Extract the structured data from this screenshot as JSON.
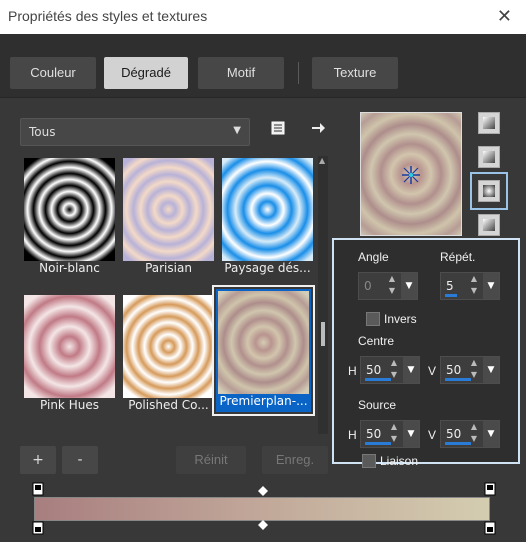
{
  "window": {
    "title": "Propriétés des styles et textures",
    "close_glyph": "✕"
  },
  "tabs": [
    {
      "label": "Couleur",
      "active": false
    },
    {
      "label": "Dégradé",
      "active": true
    },
    {
      "label": "Motif",
      "active": false
    },
    {
      "label": "Texture",
      "active": false
    }
  ],
  "category": {
    "selected": "Tous"
  },
  "gradients": [
    {
      "label": "Noir-blanc"
    },
    {
      "label": "Parisian"
    },
    {
      "label": "Paysage dés..."
    },
    {
      "label": "Pink Hues"
    },
    {
      "label": "Polished Co..."
    },
    {
      "label": "Premierplan-...",
      "selected": true
    }
  ],
  "buttons": {
    "add": "+",
    "remove": "-",
    "reset": "Réinit",
    "save": "Enreg."
  },
  "popup": {
    "angle_label": "Angle",
    "angle_value": "0",
    "repeat_label": "Répét.",
    "repeat_value": "5",
    "invert_label": "Invers",
    "center_label": "Centre",
    "center_h_label": "H",
    "center_h": "50",
    "center_v_label": "V",
    "center_v": "50",
    "source_label": "Source",
    "source_h_label": "H",
    "source_h": "50",
    "source_v_label": "V",
    "source_v": "50",
    "link_label": "Liaison"
  },
  "colors": {
    "accent": "#0a64c6",
    "gradient_start": "#a87e7f",
    "gradient_end": "#d4cdb0"
  }
}
